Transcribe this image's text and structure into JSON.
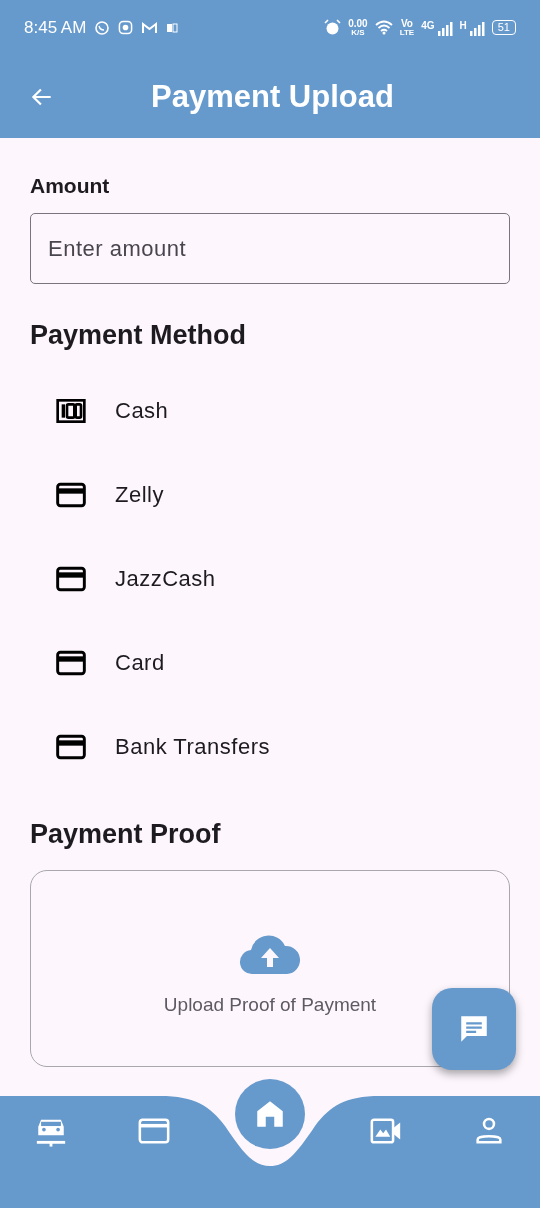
{
  "status_bar": {
    "time": "8:45 AM",
    "net_speed": "0.00",
    "net_unit": "K/S",
    "volte_top": "Vo",
    "volte_bottom": "LTE",
    "network_1": "4G",
    "network_2": "H",
    "battery": "51"
  },
  "app_bar": {
    "title": "Payment Upload"
  },
  "amount": {
    "label": "Amount",
    "placeholder": "Enter amount"
  },
  "payment_method": {
    "heading": "Payment Method",
    "items": [
      {
        "kind": "cash",
        "label": "Cash"
      },
      {
        "kind": "card",
        "label": "Zelly"
      },
      {
        "kind": "card",
        "label": "JazzCash"
      },
      {
        "kind": "card",
        "label": "Card"
      },
      {
        "kind": "card",
        "label": "Bank Transfers"
      }
    ]
  },
  "payment_proof": {
    "heading": "Payment Proof",
    "upload_text": "Upload Proof of Payment"
  },
  "bottom_nav": {
    "items": [
      {
        "kind": "car"
      },
      {
        "kind": "card"
      },
      {
        "kind": "home"
      },
      {
        "kind": "media"
      },
      {
        "kind": "person"
      }
    ]
  }
}
